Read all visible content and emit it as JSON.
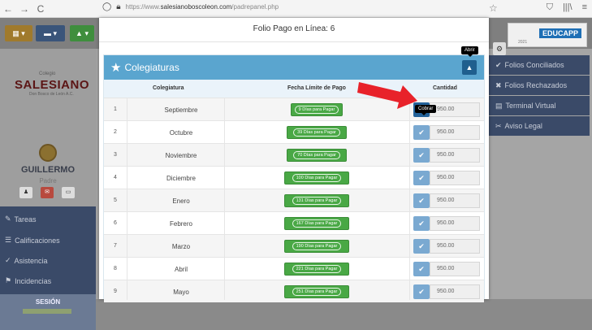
{
  "browser": {
    "back": "←",
    "forward": "→",
    "reload": "C",
    "url_prefix": "https://www.",
    "url_domain": "salesianoboscoleon.com",
    "url_path": "/padrepanel.php",
    "bookmark_icon": "☆",
    "shield_icon": "⛉",
    "library_icon": "|||\\",
    "menu_icon": "≡"
  },
  "background_app": {
    "school_small": "Colegio",
    "school_name": "SALESIANO",
    "school_sub": "Don Bosco de León A.C.",
    "user_name": "GUILLERMO",
    "user_role": "Padre",
    "menu": [
      "Tareas",
      "Calificaciones",
      "Asistencia",
      "Incidencias"
    ],
    "session_label": "SESIÓN",
    "brand": "EDUCAPP",
    "brand_year": "2021",
    "right_menu": [
      "Folios Conciliados",
      "Folios Rechazados",
      "Terminal Virtual",
      "Aviso Legal"
    ]
  },
  "modal": {
    "title": "Folio Pago en Línea: 6",
    "panel_title": "Colegiaturas",
    "tooltip_open": "Abrir",
    "tooltip_charge": "Cobrar",
    "columns": {
      "mes": "Colegiatura",
      "fecha": "Fecha Límite de Pago",
      "cantidad": "Cantidad"
    },
    "rows": [
      {
        "n": "1",
        "mes": "Septiembre",
        "fecha": "9 Días para Pagar",
        "monto": "950.00"
      },
      {
        "n": "2",
        "mes": "Octubre",
        "fecha": "39 Días para Pagar",
        "monto": "950.00"
      },
      {
        "n": "3",
        "mes": "Noviembre",
        "fecha": "70 Días para Pagar",
        "monto": "950.00"
      },
      {
        "n": "4",
        "mes": "Diciembre",
        "fecha": "100 Días para Pagar",
        "monto": "950.00"
      },
      {
        "n": "5",
        "mes": "Enero",
        "fecha": "131 Días para Pagar",
        "monto": "950.00"
      },
      {
        "n": "6",
        "mes": "Febrero",
        "fecha": "167 Días para Pagar",
        "monto": "950.00"
      },
      {
        "n": "7",
        "mes": "Marzo",
        "fecha": "190 Días para Pagar",
        "monto": "950.00"
      },
      {
        "n": "8",
        "mes": "Abril",
        "fecha": "221 Días para Pagar",
        "monto": "950.00"
      },
      {
        "n": "9",
        "mes": "Mayo",
        "fecha": "251 Días para Pagar",
        "monto": "950.00"
      }
    ]
  },
  "colors": {
    "accent": "#5aa5cf",
    "green": "#49a845",
    "check": "#7aa9d1",
    "arrow": "#e8222a"
  }
}
